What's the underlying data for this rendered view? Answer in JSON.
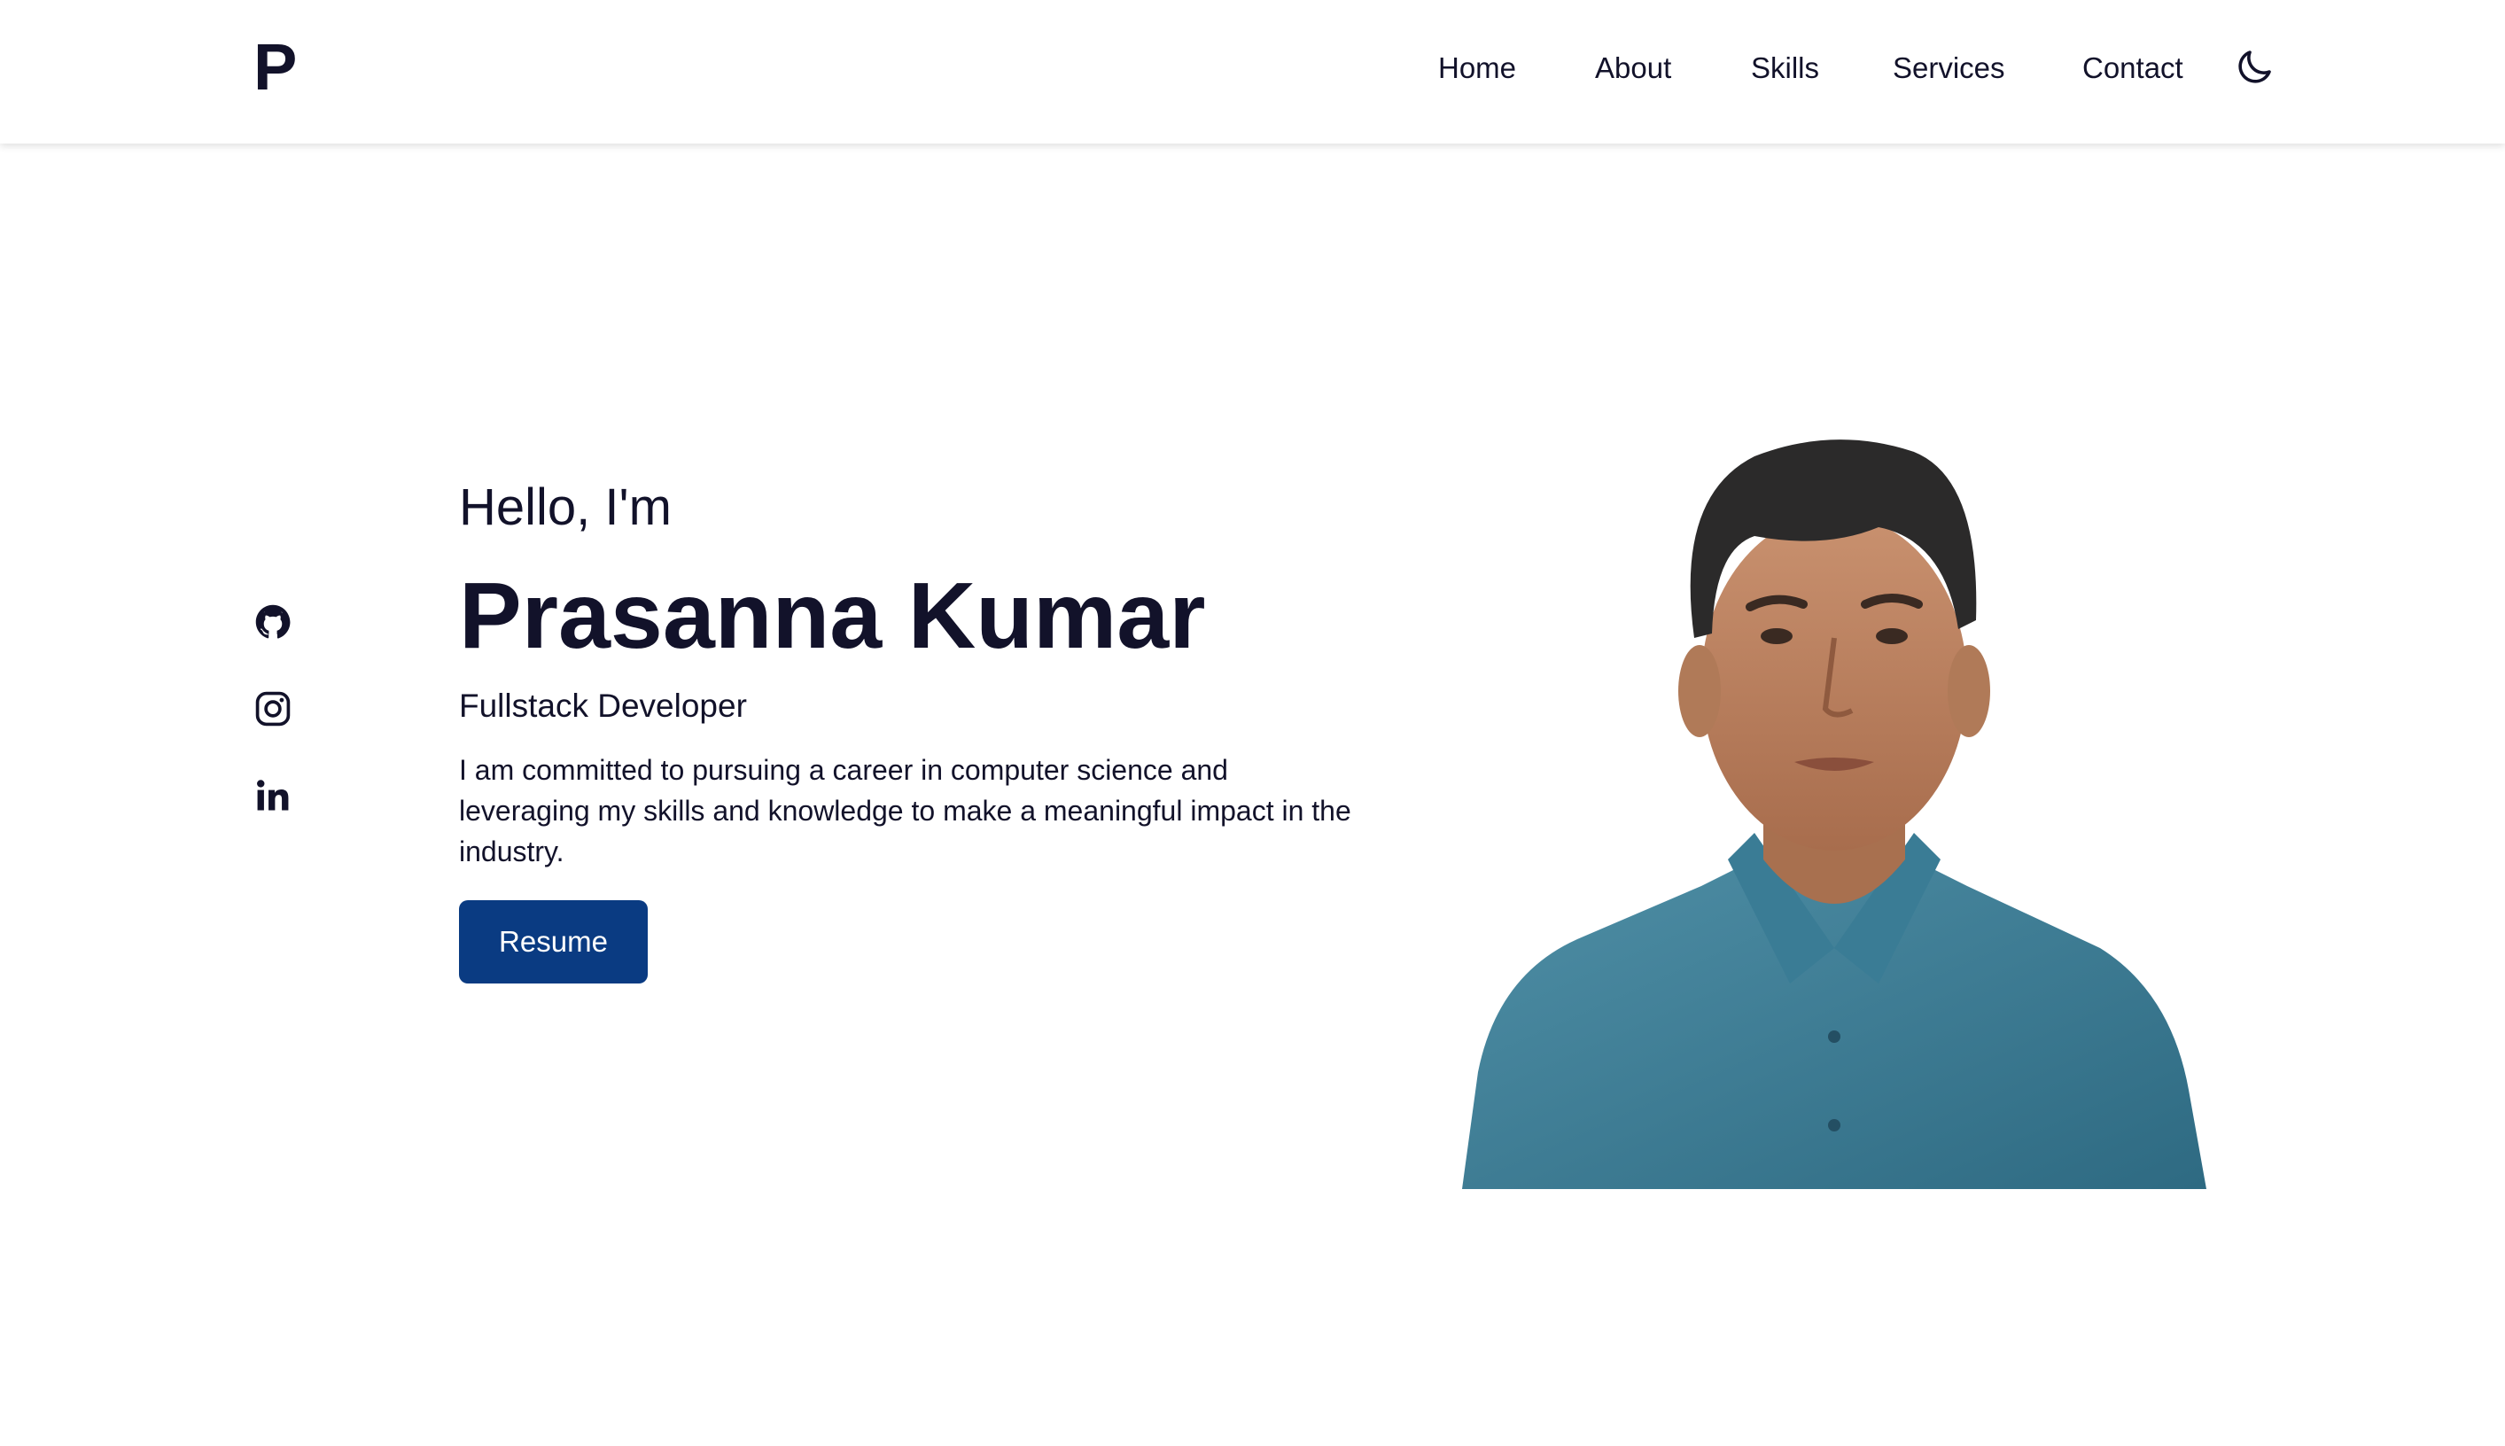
{
  "header": {
    "logo": "P",
    "nav": [
      {
        "label": "Home"
      },
      {
        "label": "About"
      },
      {
        "label": "Skills"
      },
      {
        "label": "Services"
      },
      {
        "label": "Contact"
      }
    ],
    "theme_toggle_icon": "moon-icon"
  },
  "socials": [
    {
      "icon": "github-icon"
    },
    {
      "icon": "instagram-icon"
    },
    {
      "icon": "linkedin-icon"
    }
  ],
  "hero": {
    "greeting": "Hello, I'm",
    "name": "Prasanna Kumar",
    "role": "Fullstack Developer",
    "bio": "I am committed to pursuing a career in computer science and leveraging my skills and knowledge to make a meaningful impact in the industry.",
    "resume_label": "Resume"
  },
  "colors": {
    "text": "#12122a",
    "accent": "#0a3b82",
    "background": "#ffffff"
  }
}
